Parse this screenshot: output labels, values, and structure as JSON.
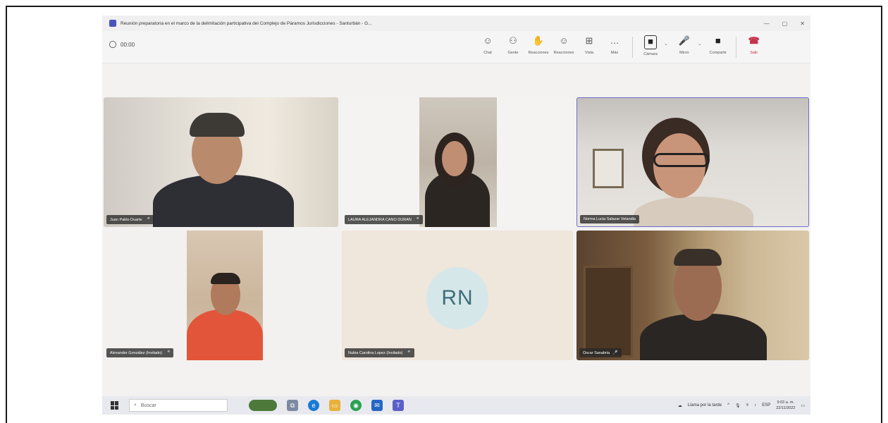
{
  "window": {
    "title": "Reunión preparatoria en el marco de la delimitación participativa del Complejo de Páramos Jurisdicciones - Santurbán - G...",
    "minimize": "—",
    "maximize": "▢",
    "close": "✕"
  },
  "meeting": {
    "timer": "00:00"
  },
  "toolbar": {
    "items": [
      {
        "icon": "chat-icon",
        "glyph": "☺",
        "label": "Chat"
      },
      {
        "icon": "people-icon",
        "glyph": "⚇",
        "label": "Gente"
      },
      {
        "icon": "raise-hand-icon",
        "glyph": "✋",
        "label": "Reacciones"
      },
      {
        "icon": "reactions-icon",
        "glyph": "☺",
        "label": "Reacciones"
      },
      {
        "icon": "view-icon",
        "glyph": "⊞",
        "label": "Vista"
      },
      {
        "icon": "more-icon",
        "glyph": "…",
        "label": "Más"
      }
    ],
    "camera": {
      "glyph": "■",
      "label": "Cámara"
    },
    "mic": {
      "glyph": "🎤",
      "label": "Micro"
    },
    "share": {
      "glyph": "■",
      "label": "Compartir"
    },
    "leave": {
      "glyph": "☎",
      "label": "Salir"
    }
  },
  "participants": [
    {
      "name": "Juan Pablo Duarte",
      "mic": "🎤"
    },
    {
      "name": "LAURA ALEJANDRA CANO DURAN",
      "mic": "🎤"
    },
    {
      "name": "Norma Lucia Salazar Velandia",
      "mic": ""
    },
    {
      "name": "Alexander González (Invitado)",
      "mic": "🎤"
    },
    {
      "name": "Nubia Carolina Lopez (Invitado)",
      "mic": "🎤",
      "initials": "RN"
    },
    {
      "name": "Oscar Sanabria",
      "mic": "🎤"
    }
  ],
  "taskbar": {
    "search_placeholder": "Buscar",
    "weather": "Llama por la tarde",
    "lang": "ESP",
    "time": "9:03 a. m.",
    "date": "22/11/2022"
  }
}
